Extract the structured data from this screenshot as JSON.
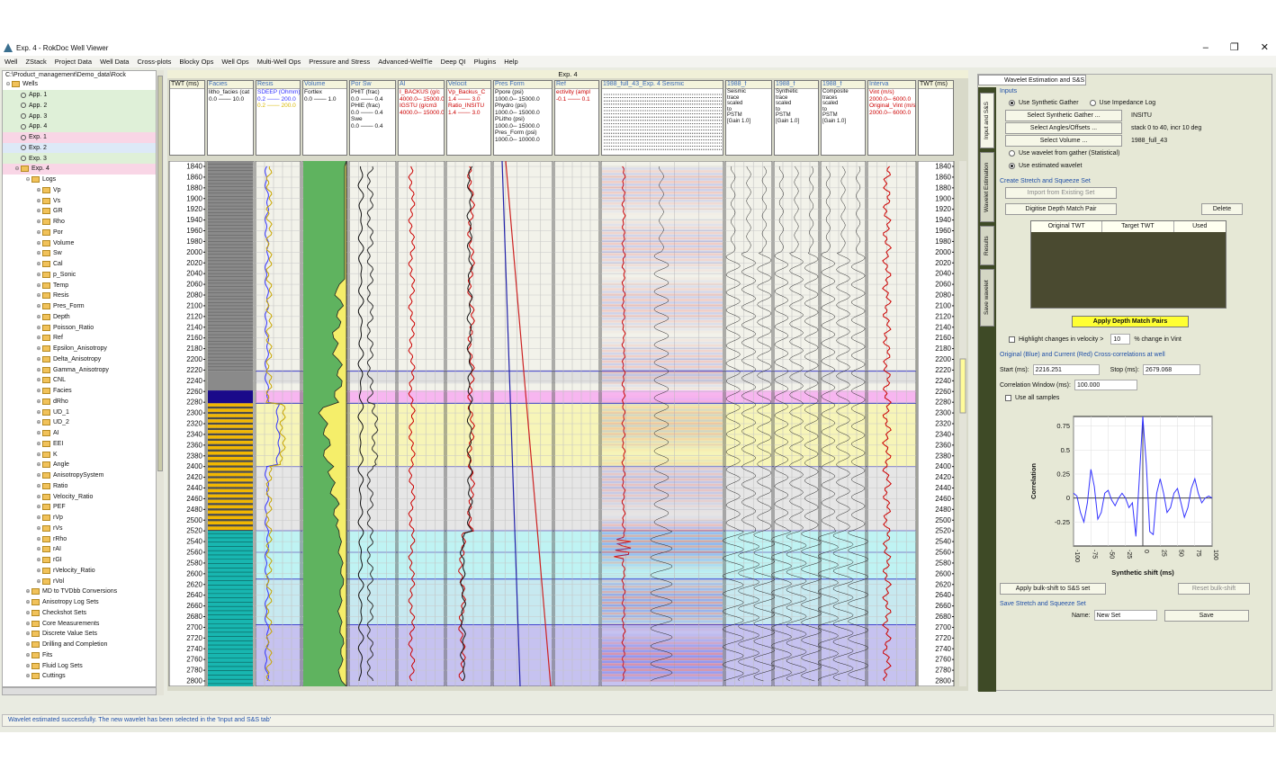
{
  "window": {
    "title": "Exp. 4 - RokDoc Well Viewer",
    "minimize": "–",
    "maximize": "❐",
    "close": "✕"
  },
  "menu": [
    "Well",
    "ZStack",
    "Project Data",
    "Well Data",
    "Cross-plots",
    "Blocky Ops",
    "Well Ops",
    "Multi-Well Ops",
    "Pressure and Stress",
    "Advanced-WellTie",
    "Deep QI",
    "Plugins",
    "Help"
  ],
  "tree": {
    "path": "C:\\Product_management\\Demo_data\\Rock",
    "wells_label": "Wells",
    "wells": [
      "App. 1",
      "App. 2",
      "App. 3",
      "App. 4",
      "Exp. 1",
      "Exp. 2",
      "Exp. 3",
      "Exp. 4"
    ],
    "logs_label": "Logs",
    "logs": [
      "Vp",
      "Vs",
      "GR",
      "Rho",
      "Por",
      "Volume",
      "Sw",
      "Cal",
      "p_Sonic",
      "Temp",
      "Resis",
      "Pres_Form",
      "Depth",
      "Poisson_Ratio",
      "Ref",
      "Epsilon_Anisotropy",
      "Delta_Anisotropy",
      "Gamma_Anisotropy",
      "CNL",
      "Facies",
      "dRho",
      "UD_1",
      "UD_2",
      "AI",
      "EEI",
      "K",
      "Angle",
      "AnisotropySystem",
      "Ratio",
      "Velocity_Ratio",
      "PEF",
      "rVp",
      "rVs",
      "rRho",
      "rAI",
      "rGI",
      "rVelocity_Ratio",
      "rVol"
    ],
    "groups": [
      "MD to TVDbb Conversions",
      "Anisotropy Log Sets",
      "Checkshot Sets",
      "Core Measurements",
      "Discrete Value Sets",
      "Drilling and Completion",
      "Fits",
      "Fluid Log Sets",
      "Cuttings"
    ]
  },
  "wellviewer": {
    "title": "Exp. 4",
    "twt_label": "TWT (ms)",
    "tracks": [
      {
        "name": "Facies",
        "lines": [
          "litho_facies (cat",
          "0.0 ─── 10.0"
        ]
      },
      {
        "name": "Resis",
        "lines": [
          "SDEEP (Ohmm)",
          "0.2 ─── 200.0",
          "0.2 ─── 200.0"
        ]
      },
      {
        "name": "Volume",
        "lines": [
          "Fortlex",
          "0.0 ─── 1.0"
        ]
      },
      {
        "name": "Por Sw",
        "lines": [
          "PHIT (frac)",
          "0.0 ─── 0.4",
          "PHIE (frac)",
          "0.0 ─── 0.4",
          "Swe",
          "0.0 ─── 0.4"
        ]
      },
      {
        "name": "AI",
        "lines": [
          "I_BACKUS (g/c",
          "4000.0─ 15000.0",
          "IGSTU (g/cm3",
          "4000.0─ 15000.0"
        ]
      },
      {
        "name": "Velocit",
        "lines": [
          "Vp_Backus_C",
          "1.4 ─── 3.0",
          "Ratio_INSITU",
          "1.4 ─── 3.0"
        ]
      },
      {
        "name": "Pres Form",
        "lines": [
          "Ppore (psi)",
          "1000.0─ 15000.0",
          "Phydro (psi)",
          "1000.0─ 15000.0",
          "PLitho (psi)",
          "1000.0─ 15000.0",
          "Pres_Form (psi)",
          "1000.0─ 10000.0"
        ]
      },
      {
        "name": "Ref",
        "lines": [
          "ectivity (ampl",
          "-0.1 ─── 0.1"
        ]
      },
      {
        "name": "1988_full_43_Exp. 4 Seismic",
        "lines": []
      },
      {
        "name": "1988_f",
        "lines": [
          "Seismic",
          "trace",
          "scaled",
          "to",
          "PSTM",
          "[Gain 1.0]"
        ]
      },
      {
        "name": "1988_f",
        "lines": [
          "Synthetic",
          "trace",
          "scaled",
          "to",
          "PSTM",
          "[Gain 1.0]"
        ]
      },
      {
        "name": "1988_f",
        "lines": [
          "Composite",
          "traces",
          "scaled",
          "to",
          "PSTM",
          "[Gain 1.0]"
        ]
      },
      {
        "name": "Interva",
        "lines": [
          "Vint (m/s)",
          "2000.0─ 6000.0",
          "Original_Vint (m/s)",
          "2000.0─ 6000.0"
        ]
      }
    ],
    "depth_ticks": [
      1840,
      1860,
      1880,
      1900,
      1920,
      1940,
      1960,
      1980,
      2000,
      2020,
      2040,
      2060,
      2080,
      2100,
      2120,
      2140,
      2160,
      2180,
      2200,
      2220,
      2240,
      2260,
      2280,
      2300,
      2320,
      2340,
      2360,
      2380,
      2400,
      2420,
      2440,
      2460,
      2480,
      2500,
      2520,
      2540,
      2560,
      2580,
      2600,
      2620,
      2640,
      2660,
      2680,
      2700,
      2720,
      2740,
      2760,
      2780,
      2800
    ]
  },
  "rightpanel": {
    "tab": "Wavelet Estimation and S&S",
    "vtabs": [
      "Input and S&S",
      "Wavelet Estimation",
      "Results",
      "Save wavelet"
    ],
    "inputs_title": "Inputs",
    "use_synthetic_gather": "Use Synthetic Gather",
    "use_impedance_log": "Use Impedance Log",
    "select_synthetic_btn": "Select Synthetic Gather ...",
    "synthetic_value": "INSITU",
    "select_angles_btn": "Select Angles/Offsets ...",
    "angles_value": "stack 0 to 40, incr 10 deg",
    "select_volume_btn": "Select Volume ...",
    "volume_value": "1988_full_43",
    "wavelet_from_gather": "Use wavelet from gather (Statistical)",
    "use_estimated_wavelet": "Use estimated wavelet",
    "ss_title": "Create Stretch and Squeeze Set",
    "import_btn": "Import from Existing Set",
    "digitise_btn": "Digitise Depth Match Pair",
    "delete_btn": "Delete",
    "table_cols": [
      "Original TWT",
      "Target TWT",
      "Used"
    ],
    "apply_btn": "Apply Depth Match Pairs",
    "highlight_label": "Highlight changes in velocity >",
    "highlight_value": "10",
    "highlight_unit": "% change in Vint",
    "xcorr_title": "Original (Blue) and Current (Red) Cross-correlations at well",
    "start_label": "Start (ms):",
    "start_value": "2216.251",
    "stop_label": "Stop (ms):",
    "stop_value": "2679.068",
    "corr_window_label": "Correlation Window (ms):",
    "corr_window_value": "100.000",
    "use_all_samples": "Use all samples",
    "apply_bulk_btn": "Apply bulk-shift to S&S set",
    "reset_bulk_btn": "Reset bulk-shift",
    "save_title": "Save Stretch and Squeeze Set",
    "name_label": "Name:",
    "name_value": "New Set",
    "save_btn": "Save"
  },
  "chart_data": {
    "type": "line",
    "xlabel": "Synthetic shift (ms)",
    "ylabel": "Correlation",
    "xlim": [
      -100,
      100
    ],
    "ylim": [
      -0.5,
      0.85
    ],
    "x_ticks": [
      -100,
      -75,
      -50,
      -25,
      0,
      25,
      50,
      75,
      100
    ],
    "y_ticks": [
      0.75,
      0.5,
      0.25,
      0,
      -0.25
    ],
    "series": [
      {
        "color": "#3333ff",
        "x": [
          -100,
          -95,
          -90,
          -85,
          -80,
          -75,
          -70,
          -65,
          -60,
          -55,
          -50,
          -45,
          -40,
          -35,
          -30,
          -25,
          -20,
          -15,
          -10,
          -5,
          0,
          5,
          10,
          15,
          20,
          25,
          30,
          35,
          40,
          45,
          50,
          55,
          60,
          65,
          70,
          75,
          80,
          85,
          90,
          95,
          100
        ],
        "y": [
          0.05,
          0.02,
          -0.15,
          -0.25,
          -0.05,
          0.3,
          0.12,
          -0.22,
          -0.15,
          0.05,
          0.08,
          -0.02,
          -0.08,
          0.0,
          0.05,
          0.0,
          -0.1,
          -0.05,
          -0.4,
          0.2,
          0.85,
          0.35,
          -0.35,
          -0.38,
          0.05,
          0.2,
          0.05,
          -0.15,
          -0.1,
          0.05,
          0.1,
          -0.05,
          -0.2,
          -0.1,
          0.1,
          0.2,
          0.05,
          -0.05,
          0.0,
          0.02,
          0.0
        ]
      }
    ]
  },
  "status": "Wavelet estimated successfully. The new wavelet has been selected in the 'Input and S&S tab'",
  "colors": {
    "accent": "#1f4fa8",
    "apply": "#ffff33",
    "vtab_bg": "#3e4a26"
  }
}
